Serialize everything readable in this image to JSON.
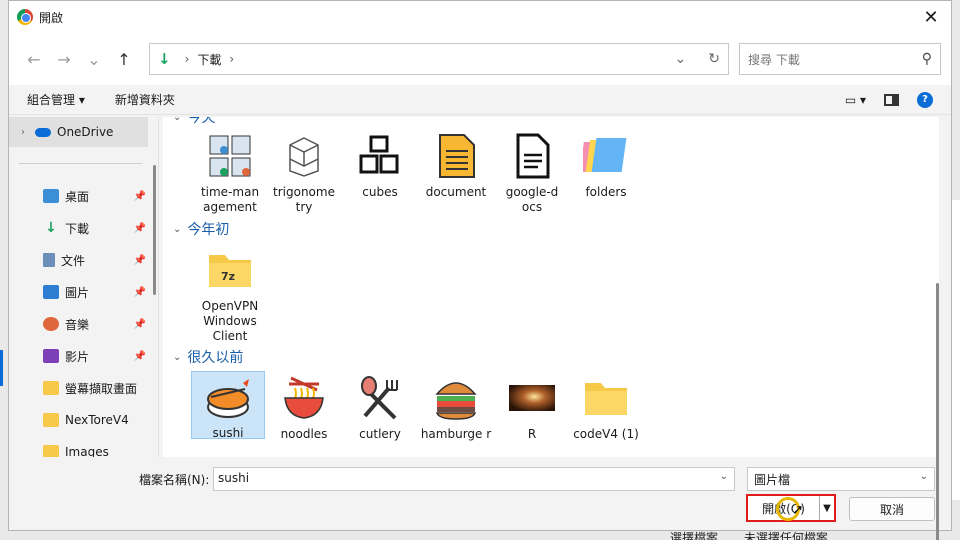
{
  "dialog": {
    "title": "開啟",
    "close_glyph": "✕"
  },
  "nav": {
    "back": "←",
    "forward": "→",
    "recent": "⌄",
    "up": "↑",
    "address_folder": "下載",
    "address_sep1": "›",
    "address_sep2": "›",
    "search_placeholder": "搜尋 下載"
  },
  "toolbar": {
    "organize": "組合管理 ▾",
    "new_folder": "新增資料夾",
    "view": "▾",
    "help": "?"
  },
  "sidebar": {
    "onedrive": "OneDrive",
    "items": [
      {
        "label": "桌面",
        "icon": "desktop-icon",
        "pinned": true
      },
      {
        "label": "下載",
        "icon": "download-icon",
        "pinned": true
      },
      {
        "label": "文件",
        "icon": "document-icon",
        "pinned": true
      },
      {
        "label": "圖片",
        "icon": "pictures-icon",
        "pinned": true
      },
      {
        "label": "音樂",
        "icon": "music-icon",
        "pinned": true
      },
      {
        "label": "影片",
        "icon": "videos-icon",
        "pinned": true
      },
      {
        "label": "螢幕擷取畫面",
        "icon": "folder-icon",
        "pinned": false
      },
      {
        "label": "NexToreV4",
        "icon": "folder-icon",
        "pinned": false
      },
      {
        "label": "Images",
        "icon": "folder-icon",
        "pinned": false
      }
    ]
  },
  "groups": {
    "g0": "今天",
    "g1": "今年初",
    "g2": "很久以前"
  },
  "files": {
    "row1": [
      "time-man agement",
      "trigonome try",
      "cubes",
      "document",
      "google-d ocs",
      "folders"
    ],
    "row2": [
      "OpenVPN Windows Client"
    ],
    "row3": [
      "sushi",
      "noodles",
      "cutlery",
      "hamburge r",
      "R",
      "codeV4 (1)"
    ]
  },
  "bottom": {
    "filename_label": "檔案名稱(N):",
    "filename_value": "sushi",
    "filetype_value": "圖片檔",
    "open_label": "開啟(O)",
    "cancel_label": "取消"
  },
  "background": {
    "text1": "選擇檔案",
    "text2": "未選擇任何檔案"
  },
  "colors": {
    "accent": "#0a6cd6",
    "highlight_border": "#e01b1b",
    "selection": "#cce4f7"
  }
}
